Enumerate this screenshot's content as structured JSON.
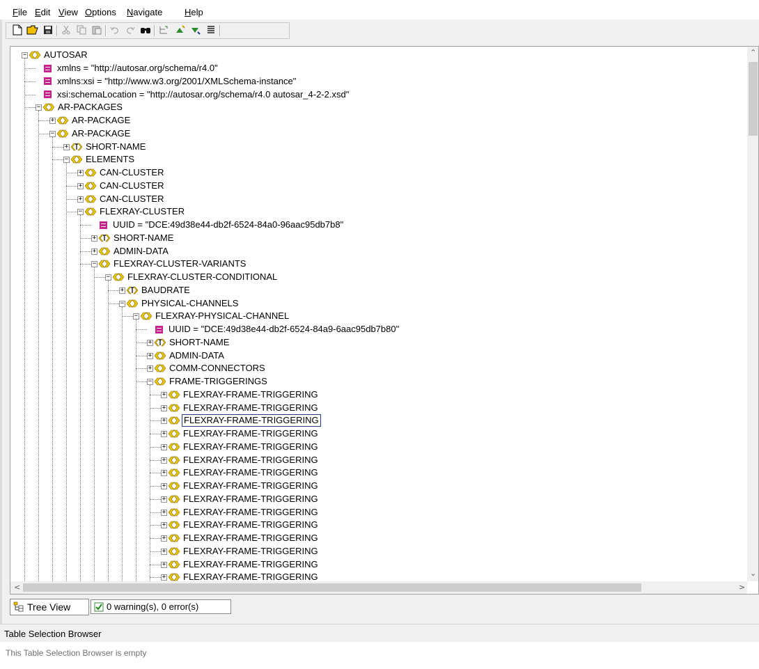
{
  "menu": [
    {
      "pre": "",
      "ul": "F",
      "post": "ile"
    },
    {
      "pre": "",
      "ul": "E",
      "post": "dit"
    },
    {
      "pre": "",
      "ul": "V",
      "post": "iew"
    },
    {
      "pre": "",
      "ul": "O",
      "post": "ptions"
    },
    {
      "pre": "",
      "ul": "N",
      "post": "avigate"
    },
    {
      "pre": "",
      "ul": "H",
      "post": "elp"
    }
  ],
  "toolbar": {
    "buttons": [
      "new-file-icon",
      "open-folder-icon",
      "save-icon",
      "cut-icon",
      "copy-icon",
      "paste-icon",
      "undo-icon",
      "redo-icon",
      "find-icon",
      "tree-expand-icon",
      "move-up-icon",
      "move-down-icon",
      "list-icon"
    ]
  },
  "tree": {
    "nodes": [
      {
        "depth": 0,
        "kind": "elem",
        "expander": "minus",
        "label": "AUTOSAR"
      },
      {
        "depth": 1,
        "kind": "attr",
        "expander": "none",
        "label": "xmlns = \"http://autosar.org/schema/r4.0\""
      },
      {
        "depth": 1,
        "kind": "attr",
        "expander": "none",
        "label": "xmlns:xsi = \"http://www.w3.org/2001/XMLSchema-instance\""
      },
      {
        "depth": 1,
        "kind": "attr",
        "expander": "none",
        "label": "xsi:schemaLocation = \"http://autosar.org/schema/r4.0 autosar_4-2-2.xsd\""
      },
      {
        "depth": 1,
        "kind": "elem",
        "expander": "minus",
        "label": "AR-PACKAGES"
      },
      {
        "depth": 2,
        "kind": "elem",
        "expander": "plus",
        "label": "AR-PACKAGE"
      },
      {
        "depth": 2,
        "kind": "elem",
        "expander": "minus",
        "label": "AR-PACKAGE"
      },
      {
        "depth": 3,
        "kind": "text",
        "expander": "plus",
        "label": "SHORT-NAME"
      },
      {
        "depth": 3,
        "kind": "elem",
        "expander": "minus",
        "label": "ELEMENTS"
      },
      {
        "depth": 4,
        "kind": "elem",
        "expander": "plus",
        "label": "CAN-CLUSTER"
      },
      {
        "depth": 4,
        "kind": "elem",
        "expander": "plus",
        "label": "CAN-CLUSTER"
      },
      {
        "depth": 4,
        "kind": "elem",
        "expander": "plus",
        "label": "CAN-CLUSTER"
      },
      {
        "depth": 4,
        "kind": "elem",
        "expander": "minus",
        "label": "FLEXRAY-CLUSTER"
      },
      {
        "depth": 5,
        "kind": "attr",
        "expander": "none",
        "label": "UUID = \"DCE:49d38e44-db2f-6524-84a0-96aac95db7b8\""
      },
      {
        "depth": 5,
        "kind": "text",
        "expander": "plus",
        "label": "SHORT-NAME"
      },
      {
        "depth": 5,
        "kind": "elem",
        "expander": "plus",
        "label": "ADMIN-DATA"
      },
      {
        "depth": 5,
        "kind": "elem",
        "expander": "minus",
        "label": "FLEXRAY-CLUSTER-VARIANTS"
      },
      {
        "depth": 6,
        "kind": "elem",
        "expander": "minus",
        "label": "FLEXRAY-CLUSTER-CONDITIONAL"
      },
      {
        "depth": 7,
        "kind": "text",
        "expander": "plus",
        "label": "BAUDRATE"
      },
      {
        "depth": 7,
        "kind": "elem",
        "expander": "minus",
        "label": "PHYSICAL-CHANNELS"
      },
      {
        "depth": 8,
        "kind": "elem",
        "expander": "minus",
        "label": "FLEXRAY-PHYSICAL-CHANNEL"
      },
      {
        "depth": 9,
        "kind": "attr",
        "expander": "none",
        "label": "UUID = \"DCE:49d38e44-db2f-6524-84a9-6aac95db7b80\""
      },
      {
        "depth": 9,
        "kind": "text",
        "expander": "plus",
        "label": "SHORT-NAME"
      },
      {
        "depth": 9,
        "kind": "elem",
        "expander": "plus",
        "label": "ADMIN-DATA"
      },
      {
        "depth": 9,
        "kind": "elem",
        "expander": "plus",
        "label": "COMM-CONNECTORS"
      },
      {
        "depth": 9,
        "kind": "elem",
        "expander": "minus",
        "label": "FRAME-TRIGGERINGS"
      },
      {
        "depth": 10,
        "kind": "elem",
        "expander": "plus",
        "label": "FLEXRAY-FRAME-TRIGGERING"
      },
      {
        "depth": 10,
        "kind": "elem",
        "expander": "plus",
        "label": "FLEXRAY-FRAME-TRIGGERING"
      },
      {
        "depth": 10,
        "kind": "elem",
        "expander": "plus",
        "label": "FLEXRAY-FRAME-TRIGGERING",
        "selected": true
      },
      {
        "depth": 10,
        "kind": "elem",
        "expander": "plus",
        "label": "FLEXRAY-FRAME-TRIGGERING"
      },
      {
        "depth": 10,
        "kind": "elem",
        "expander": "plus",
        "label": "FLEXRAY-FRAME-TRIGGERING"
      },
      {
        "depth": 10,
        "kind": "elem",
        "expander": "plus",
        "label": "FLEXRAY-FRAME-TRIGGERING"
      },
      {
        "depth": 10,
        "kind": "elem",
        "expander": "plus",
        "label": "FLEXRAY-FRAME-TRIGGERING"
      },
      {
        "depth": 10,
        "kind": "elem",
        "expander": "plus",
        "label": "FLEXRAY-FRAME-TRIGGERING"
      },
      {
        "depth": 10,
        "kind": "elem",
        "expander": "plus",
        "label": "FLEXRAY-FRAME-TRIGGERING"
      },
      {
        "depth": 10,
        "kind": "elem",
        "expander": "plus",
        "label": "FLEXRAY-FRAME-TRIGGERING"
      },
      {
        "depth": 10,
        "kind": "elem",
        "expander": "plus",
        "label": "FLEXRAY-FRAME-TRIGGERING"
      },
      {
        "depth": 10,
        "kind": "elem",
        "expander": "plus",
        "label": "FLEXRAY-FRAME-TRIGGERING"
      },
      {
        "depth": 10,
        "kind": "elem",
        "expander": "plus",
        "label": "FLEXRAY-FRAME-TRIGGERING"
      },
      {
        "depth": 10,
        "kind": "elem",
        "expander": "plus",
        "label": "FLEXRAY-FRAME-TRIGGERING"
      },
      {
        "depth": 10,
        "kind": "elem",
        "expander": "plus",
        "label": "FLEXRAY-FRAME-TRIGGERING"
      }
    ]
  },
  "tabs": {
    "tree_view": "Tree View",
    "messages": "0 warning(s), 0 error(s)"
  },
  "table_browser": {
    "title": "Table Selection Browser",
    "empty_message": "This Table Selection Browser is empty"
  },
  "colors": {
    "element_icon": "#e8c800",
    "attribute_icon": "#c8208c",
    "selection_border": "#1e3c8c"
  }
}
